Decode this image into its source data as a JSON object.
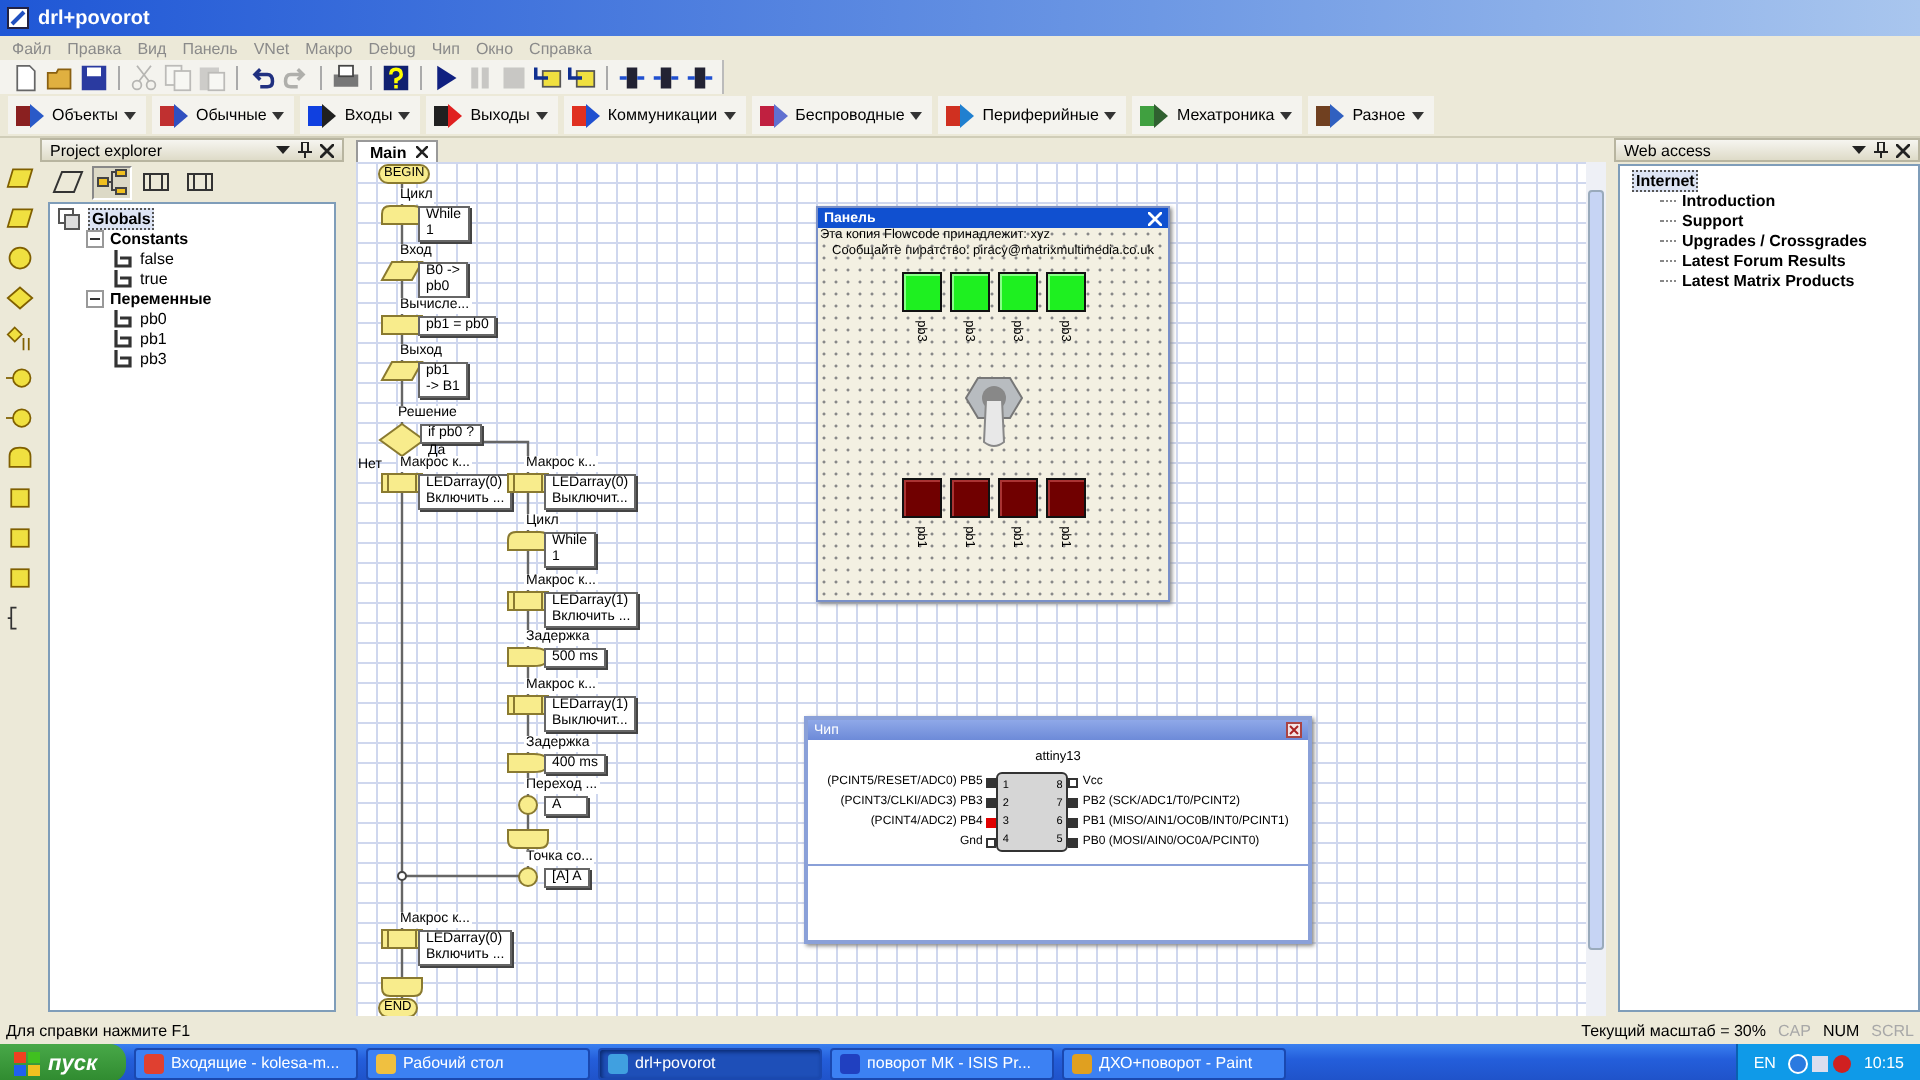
{
  "window": {
    "title": "drl+povorot"
  },
  "menu": [
    "Файл",
    "Правка",
    "Вид",
    "Панель",
    "VNet",
    "Макро",
    "Debug",
    "Чип",
    "Окно",
    "Справка"
  ],
  "toolbar": [
    {
      "kind": "new",
      "disabled": false
    },
    {
      "kind": "open",
      "disabled": false
    },
    {
      "kind": "save",
      "disabled": false
    },
    {
      "kind": "cut",
      "disabled": true
    },
    {
      "kind": "copy",
      "disabled": true
    },
    {
      "kind": "paste",
      "disabled": true
    },
    {
      "kind": "undo",
      "disabled": false
    },
    {
      "kind": "redo",
      "disabled": true
    },
    {
      "kind": "print",
      "disabled": false
    },
    {
      "kind": "help",
      "disabled": false
    },
    {
      "kind": "run",
      "disabled": false
    },
    {
      "kind": "pause",
      "disabled": true
    },
    {
      "kind": "stop",
      "disabled": true
    },
    {
      "kind": "step_into",
      "disabled": false
    },
    {
      "kind": "step_over",
      "disabled": false
    },
    {
      "kind": "chip_a",
      "disabled": false
    },
    {
      "kind": "chip_b",
      "disabled": false
    },
    {
      "kind": "chip_c",
      "disabled": false
    }
  ],
  "component_toolbar": [
    {
      "label": "Объекты",
      "kind": "objects"
    },
    {
      "label": "Обычные",
      "kind": "common"
    },
    {
      "label": "Входы",
      "kind": "inputs"
    },
    {
      "label": "Выходы",
      "kind": "outputs"
    },
    {
      "label": "Коммуникации",
      "kind": "comms"
    },
    {
      "label": "Беспроводные",
      "kind": "wireless"
    },
    {
      "label": "Периферийные",
      "kind": "peripheral"
    },
    {
      "label": "Мехатроника",
      "kind": "mechatronics"
    },
    {
      "label": "Разное",
      "kind": "misc"
    }
  ],
  "project_explorer": {
    "title": "Project explorer",
    "tabs": [
      {
        "kind": "io",
        "selected": false
      },
      {
        "kind": "tree",
        "selected": true
      },
      {
        "kind": "macro",
        "selected": false
      },
      {
        "kind": "macro2",
        "selected": false
      }
    ],
    "tree": [
      {
        "label": "Globals",
        "selected": true,
        "children": [
          {
            "label": "Constants",
            "expanded": true,
            "children": [
              {
                "label": "false"
              },
              {
                "label": "true"
              }
            ]
          },
          {
            "label": "Переменные",
            "expanded": true,
            "children": [
              {
                "label": "pb0"
              },
              {
                "label": "pb1"
              },
              {
                "label": "pb3"
              }
            ]
          }
        ]
      }
    ]
  },
  "editor": {
    "tabs": [
      {
        "label": "Main",
        "selected": true
      }
    ],
    "flowchart": {
      "yes_label": "Да",
      "no_label": "Нет",
      "nodes": [
        {
          "kind": "terminal",
          "lines": [
            "BEGIN"
          ]
        },
        {
          "kind": "loop",
          "caption": "Цикл",
          "lines": [
            "While",
            "1"
          ]
        },
        {
          "kind": "input",
          "caption": "Вход",
          "lines": [
            "B0 ->",
            "pb0"
          ]
        },
        {
          "kind": "calc",
          "caption": "Вычисле...",
          "lines": [
            "pb1 = pb0"
          ]
        },
        {
          "kind": "output",
          "caption": "Выход",
          "lines": [
            "pb1",
            "-> B1"
          ]
        },
        {
          "kind": "decision",
          "caption": "Решение",
          "lines": [
            "if pb0 ?"
          ]
        },
        {
          "kind": "macro",
          "caption": "Макрос к...",
          "lines": [
            "LEDarray(0)",
            "Включить ..."
          ]
        },
        {
          "kind": "macro",
          "caption": "Макрос к...",
          "lines": [
            "LEDarray(0)",
            "Выключит..."
          ]
        },
        {
          "kind": "loop",
          "caption": "Цикл",
          "lines": [
            "While",
            "1"
          ]
        },
        {
          "kind": "macro",
          "caption": "Макрос к...",
          "lines": [
            "LEDarray(1)",
            "Включить ..."
          ]
        },
        {
          "kind": "delay",
          "caption": "Задержка",
          "lines": [
            "500 ms"
          ]
        },
        {
          "kind": "macro",
          "caption": "Макрос к...",
          "lines": [
            "LEDarray(1)",
            "Выключит..."
          ]
        },
        {
          "kind": "delay",
          "caption": "Задержка",
          "lines": [
            "400 ms"
          ]
        },
        {
          "kind": "goto",
          "caption": "Переход ...",
          "lines": [
            "A"
          ]
        },
        {
          "kind": "loopend"
        },
        {
          "kind": "connection",
          "caption": "Точка со...",
          "lines": [
            "[A] A"
          ]
        },
        {
          "kind": "macro",
          "caption": "Макрос к...",
          "lines": [
            "LEDarray(0)",
            "Включить ..."
          ]
        },
        {
          "kind": "loopend"
        },
        {
          "kind": "terminal",
          "lines": [
            "END"
          ]
        }
      ]
    }
  },
  "panel": {
    "title": "Панель",
    "lines": [
      "Эта копия Flowcode принадлежит: xyz",
      "Сообщайте пиратство: piracy@matrixmultimedia.co.uk"
    ],
    "leds_top": [
      {
        "label": "pb3",
        "on": true
      },
      {
        "label": "pb3",
        "on": true
      },
      {
        "label": "pb3",
        "on": true
      },
      {
        "label": "pb3",
        "on": true
      }
    ],
    "leds_bottom": [
      {
        "label": "pb1",
        "on": false
      },
      {
        "label": "pb1",
        "on": false
      },
      {
        "label": "pb1",
        "on": false
      },
      {
        "label": "pb1",
        "on": false
      }
    ]
  },
  "chip": {
    "title": "Чип",
    "name": "attiny13",
    "pins_left": [
      {
        "label": "(PCINT5/RESET/ADC0) PB5",
        "number": "1",
        "kind": "io",
        "high": false
      },
      {
        "label": "(PCINT3/CLKI/ADC3) PB3",
        "number": "2",
        "kind": "io",
        "high": false
      },
      {
        "label": "(PCINT4/ADC2) PB4",
        "number": "3",
        "kind": "io",
        "high": true
      },
      {
        "label": "Gnd",
        "number": "4",
        "kind": "power",
        "high": false
      }
    ],
    "pins_right": [
      {
        "label": "Vcc",
        "number": "8",
        "kind": "power",
        "high": false
      },
      {
        "label": "PB2 (SCK/ADC1/T0/PCINT2)",
        "number": "7",
        "kind": "io",
        "high": false
      },
      {
        "label": "PB1 (MISO/AIN1/OC0B/INT0/PCINT1)",
        "number": "6",
        "kind": "io",
        "high": false
      },
      {
        "label": "PB0 (MOSI/AIN0/OC0A/PCINT0)",
        "number": "5",
        "kind": "io",
        "high": false
      }
    ]
  },
  "web_access": {
    "title": "Web access",
    "tree": [
      {
        "label": "Internet",
        "selected": true,
        "children": [
          {
            "label": "Introduction"
          },
          {
            "label": "Support"
          },
          {
            "label": "Upgrades / Crossgrades"
          },
          {
            "label": "Latest Forum Results"
          },
          {
            "label": "Latest Matrix Products"
          }
        ]
      }
    ]
  },
  "status_bar": {
    "hint": "Для справки нажмите F1",
    "zoom": "Текущий масштаб = 30%",
    "indicators": [
      {
        "label": "CAP",
        "on": false
      },
      {
        "label": "NUM",
        "on": true
      },
      {
        "label": "SCRL",
        "on": false
      }
    ]
  },
  "taskbar": {
    "start": "пуск",
    "tasks": [
      {
        "label": "Входящие - kolesa-m...",
        "kind": "browser",
        "selected": false
      },
      {
        "label": "Рабочий стол",
        "kind": "desktop",
        "selected": false
      },
      {
        "label": "drl+povorot",
        "kind": "flowcode",
        "selected": true
      },
      {
        "label": "поворот МК - ISIS Pr...",
        "kind": "isis",
        "selected": false
      },
      {
        "label": "ДХО+поворот - Paint",
        "kind": "paint",
        "selected": false
      }
    ],
    "tray": {
      "language": "EN",
      "clock": "10:15"
    }
  }
}
